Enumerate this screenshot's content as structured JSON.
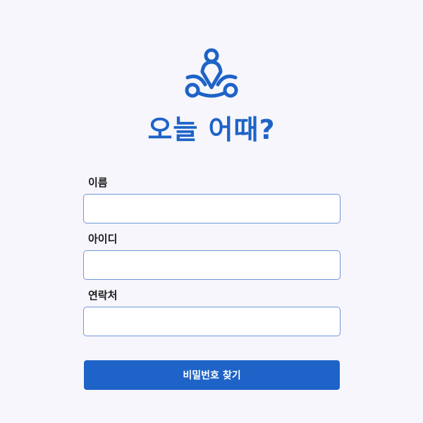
{
  "brand": {
    "logo_icon": "three-people-in-circle-icon",
    "title": "오늘 어때?",
    "color": "#1e63c7"
  },
  "form": {
    "fields": [
      {
        "label": "이름",
        "value": "",
        "placeholder": ""
      },
      {
        "label": "아이디",
        "value": "",
        "placeholder": ""
      },
      {
        "label": "연락처",
        "value": "",
        "placeholder": ""
      }
    ],
    "submit_label": "비밀번호 찾기"
  }
}
